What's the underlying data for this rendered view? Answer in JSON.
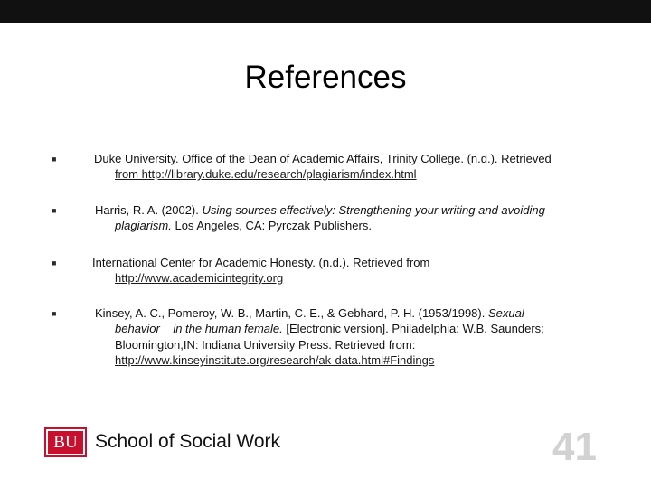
{
  "title": "References",
  "references": [
    {
      "lines": [
        "Duke University. Office of the Dean of Academic Affairs, Trinity College. (n.d.). Retrieved",
        "from http://library.duke.edu/research/plagiarism/index.html"
      ]
    },
    {
      "line1_plain": "Harris, R. A. (2002). ",
      "line1_italic": "Using sources effectively: Strengthening your writing and avoiding",
      "line2_italic": "plagiarism.",
      "line2_plain": "  Los Angeles, CA: Pyrczak Publishers."
    },
    {
      "lines": [
        "International Center for Academic Honesty. (n.d.). Retrieved from",
        "http://www.academicintegrity.org"
      ]
    },
    {
      "line1_plain": "Kinsey, A. C., Pomeroy, W. B., Martin, C. E., & Gebhard, P. H. (1953/1998). ",
      "line1_italic": "Sexual",
      "line2_italic_a": "behavior",
      "line2_italic_b": "in the human female.",
      "line2_plain": " [Electronic version]. Philadelphia: W.B. Saunders;",
      "line3": "Bloomington,IN: Indiana University Press. Retrieved from:",
      "line4": "http://www.kinseyinstitute.org/research/ak-data.html#Findings"
    }
  ],
  "footer": {
    "logo_text": "BU",
    "school": "School of Social Work",
    "page_number": "41"
  },
  "colors": {
    "brand_red": "#c8102e",
    "top_bar": "#111111",
    "page_number": "#d2d2d2"
  },
  "icons": {
    "bullet": "square-bullet-icon"
  }
}
